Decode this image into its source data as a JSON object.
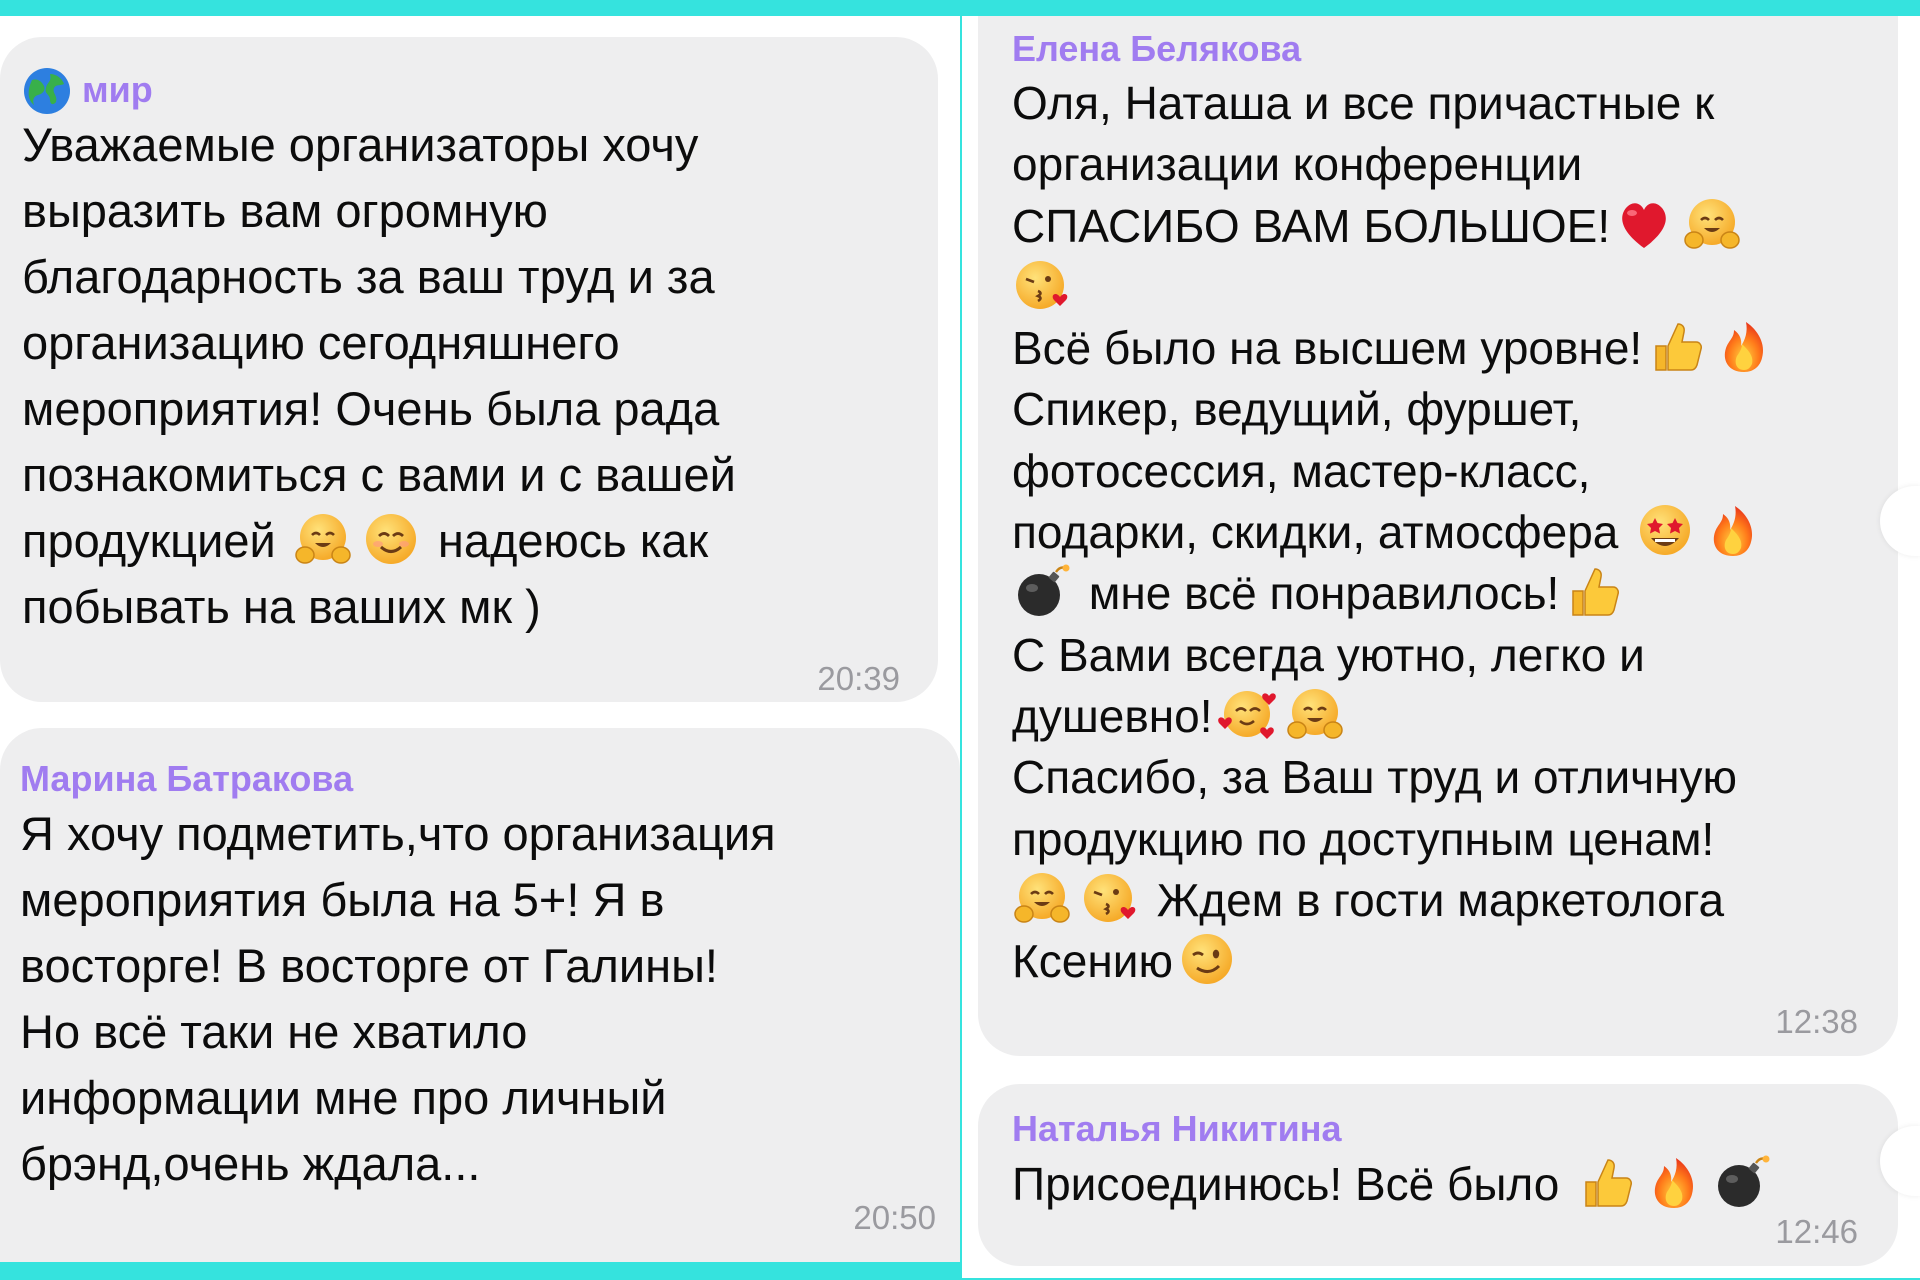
{
  "messages": [
    {
      "sender": "мир",
      "lines": [
        "Уважаемые организаторы хочу",
        "выразить вам огромную",
        "благодарность за  ваш труд и за",
        "организацию сегодняшнего",
        "мероприятия! Очень была рада",
        "познакомиться с вами и с вашей",
        "продукцией",
        "надеюсь как",
        "побывать на ваших мк )"
      ],
      "time": "20:39"
    },
    {
      "sender": "Марина Батракова",
      "lines": [
        "Я хочу подметить,что организация",
        "мероприятия была на 5+! Я в",
        "восторге! В восторге от Галины!",
        "Но всё таки не хватило",
        "информации мне про личный",
        "брэнд,очень ждала..."
      ],
      "time": "20:50"
    },
    {
      "sender": "Елена Белякова",
      "lines": [
        "Оля, Наташа и все причастные к",
        "организации конференции",
        "СПАСИБО ВАМ БОЛЬШОЕ!",
        "",
        "Всё было на высшем уровне!",
        "Спикер, ведущий, фуршет,",
        "фотосессия, мастер-класс,",
        "подарки, скидки, атмосфера",
        "мне всё понравилось!",
        "С Вами всегда уютно, легко и",
        "душевно!",
        "Спасибо, за Ваш труд и отличную",
        "продукцию по доступным ценам!",
        "Ждем в гости маркетолога",
        "Ксению"
      ],
      "time": "12:38"
    },
    {
      "sender": "Наталья Никитина",
      "lines": [
        "Присоединюсь! Всё было"
      ],
      "time": "12:46"
    }
  ],
  "icons": [
    "globe-icon",
    "hug-emoji",
    "smile-emoji",
    "heart-emoji",
    "kiss-emoji",
    "thumbs-up-emoji",
    "fire-emoji",
    "star-struck-emoji",
    "bomb-emoji",
    "smiling-hearts-emoji",
    "wink-emoji"
  ],
  "colors": {
    "background_accent": "#35e3de",
    "bubble": "#eeeeef",
    "sender_name": "#a07cf0",
    "text": "#0c0c0c",
    "time": "#9a9a9f"
  }
}
